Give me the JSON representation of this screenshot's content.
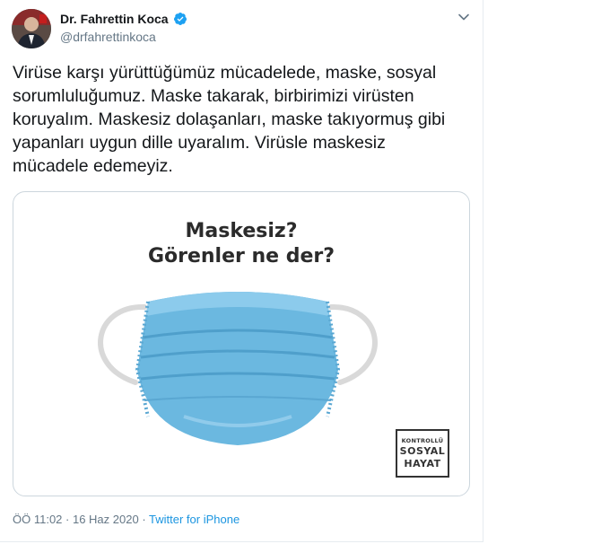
{
  "author": {
    "name": "Dr. Fahrettin Koca",
    "handle": "@drfahrettinkoca",
    "verified": true,
    "avatar_icon": "profile-avatar"
  },
  "tweet": {
    "text": "Virüse karşı yürüttüğümüz mücadelede, maske, sosyal\nsorumluluğumuz. Maske takarak, birbirimizi virüsten\nkoruyalım. Maskesiz dolaşanları, maske takıyormuş gibi\nyapanları uygun dille uyaralım. Virüsle maskesiz\nmücadele edemeyiz."
  },
  "media": {
    "headline_line1": "Maskesiz?",
    "headline_line2": "Görenler ne der?",
    "badge_line1": "KONTROLLÜ",
    "badge_line2": "SOSYAL",
    "badge_line3": "HAYAT",
    "mask_color": "#6bb8e0"
  },
  "meta": {
    "time": "ÖÖ 11:02",
    "separator": " · ",
    "date": "16 Haz 2020",
    "separator2": " · ",
    "source": "Twitter for iPhone"
  },
  "colors": {
    "link": "#1b95e0",
    "secondary_text": "#657786",
    "verified": "#1da1f2"
  }
}
